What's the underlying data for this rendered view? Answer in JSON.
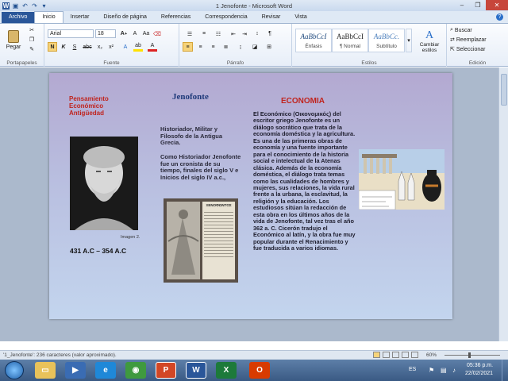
{
  "window": {
    "title": "1 Jenofonte - Microsoft Word",
    "min": "–",
    "max": "❐",
    "close": "✕"
  },
  "tabs": [
    "Archivo",
    "Inicio",
    "Insertar",
    "Diseño de página",
    "Referencias",
    "Correspondencia",
    "Revisar",
    "Vista"
  ],
  "ribbon": {
    "paste": "Pegar",
    "clipboard": "Portapapeles",
    "font_name": "Arial",
    "font_size": "18",
    "font_group": "Fuente",
    "paragraph_group": "Párrafo",
    "styles": [
      {
        "sample": "AaBbCcI",
        "name": "Énfasis"
      },
      {
        "sample": "AaBbCcI",
        "name": "¶ Normal"
      },
      {
        "sample": "AaBbCc.",
        "name": "Subtítulo"
      }
    ],
    "change_styles": "Cambiar estilos",
    "styles_group": "Estilos",
    "find": "Buscar",
    "replace": "Reemplazar",
    "select": "Seleccionar",
    "edit_group": "Edición"
  },
  "slide": {
    "heading_left": "Pensamiento Económico Antigüedad",
    "heading_center": "Jenofonte",
    "heading_right": "ECONOMIA",
    "bust_caption": "Imagen 2.",
    "dates": "431 A.C – 354 A.C",
    "bio1": "Historiador, Militar y Filosofo de la Antigua Grecia.",
    "bio2": "Como Historiador Jenofonte fue un cronista de su tiempo,  finales del siglo V e Inicios del siglo IV a.c.,",
    "economia_text": "El Económico (Οικονομικός) del escritor griego Jenofonte es un diálogo socrático que trata de la economía doméstica y la agricultura. Es una de las primeras obras de economía y una fuente importante para el conocimiento de la historia social e intelectual de la Atenas clásica. Además de la economía doméstica, el diálogo trata temas como las cualidades de hombres y mujeres, sus relaciones, la vida rural frente a la urbana, la esclavitud, la religión y la educación. Los estudiosos sitúan la redacción de esta obra en los últimos años de la vida de Jenofonte, tal vez tras el año 362 a. C. Cicerón tradujo el Económico al latín, y la obra fue muy popular durante el Renacimiento y fue traducida a varios idiomas.",
    "book_title": "ΞΕΝΟΦΩΝΤΟΣ",
    "colors": {
      "heading_red": "#c0241e",
      "heading_blue": "#1f3a7a"
    }
  },
  "status": {
    "words": "'1_Jenofonte': 236 caracteres (valor aproximado).",
    "zoom": "60%"
  },
  "taskbar": {
    "language": "ES",
    "time": "05:36 p.m.",
    "date": "22/02/2021"
  }
}
